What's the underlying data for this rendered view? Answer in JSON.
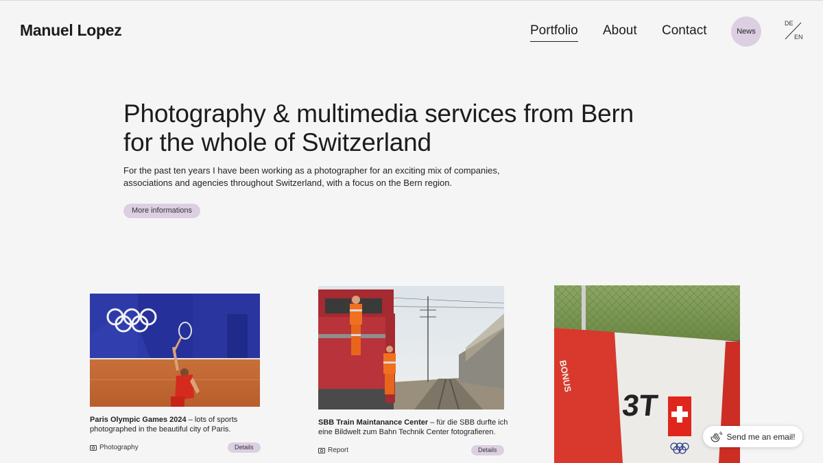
{
  "header": {
    "logo": "Manuel Lopez",
    "nav": [
      "Portfolio",
      "About",
      "Contact"
    ],
    "news": "News",
    "lang": {
      "de": "DE",
      "en": "EN"
    }
  },
  "hero": {
    "title_line1": "Photography & multimedia services from Bern",
    "title_line2": "for the whole of Switzerland",
    "text_line1": "For the past ten years I have been working as a photographer for an exciting mix of companies,",
    "text_line2": "associations and agencies throughout Switzerland, with a focus on the Bern region.",
    "button": "More informations"
  },
  "cards": [
    {
      "title": "Paris Olympic Games 2024",
      "desc_line1": " – lots of sports",
      "desc_line2": "photographed in the beautiful city of Paris.",
      "category": "Photography",
      "category_icon": "camera-icon",
      "details": "Details"
    },
    {
      "title": "SBB Train Maintanance Center",
      "desc_line1": " – für die SBB durfte ich",
      "desc_line2": "eine Bildwelt zum Bahn Technik Center fotografieren.",
      "category": "Report",
      "category_icon": "camera-icon",
      "details": "Details"
    },
    {
      "image_text": "3T"
    }
  ],
  "email_button": "Send me an email!",
  "colors": {
    "accent": "#dccfe1",
    "background": "#f5f5f5",
    "text": "#1c1c1c"
  }
}
